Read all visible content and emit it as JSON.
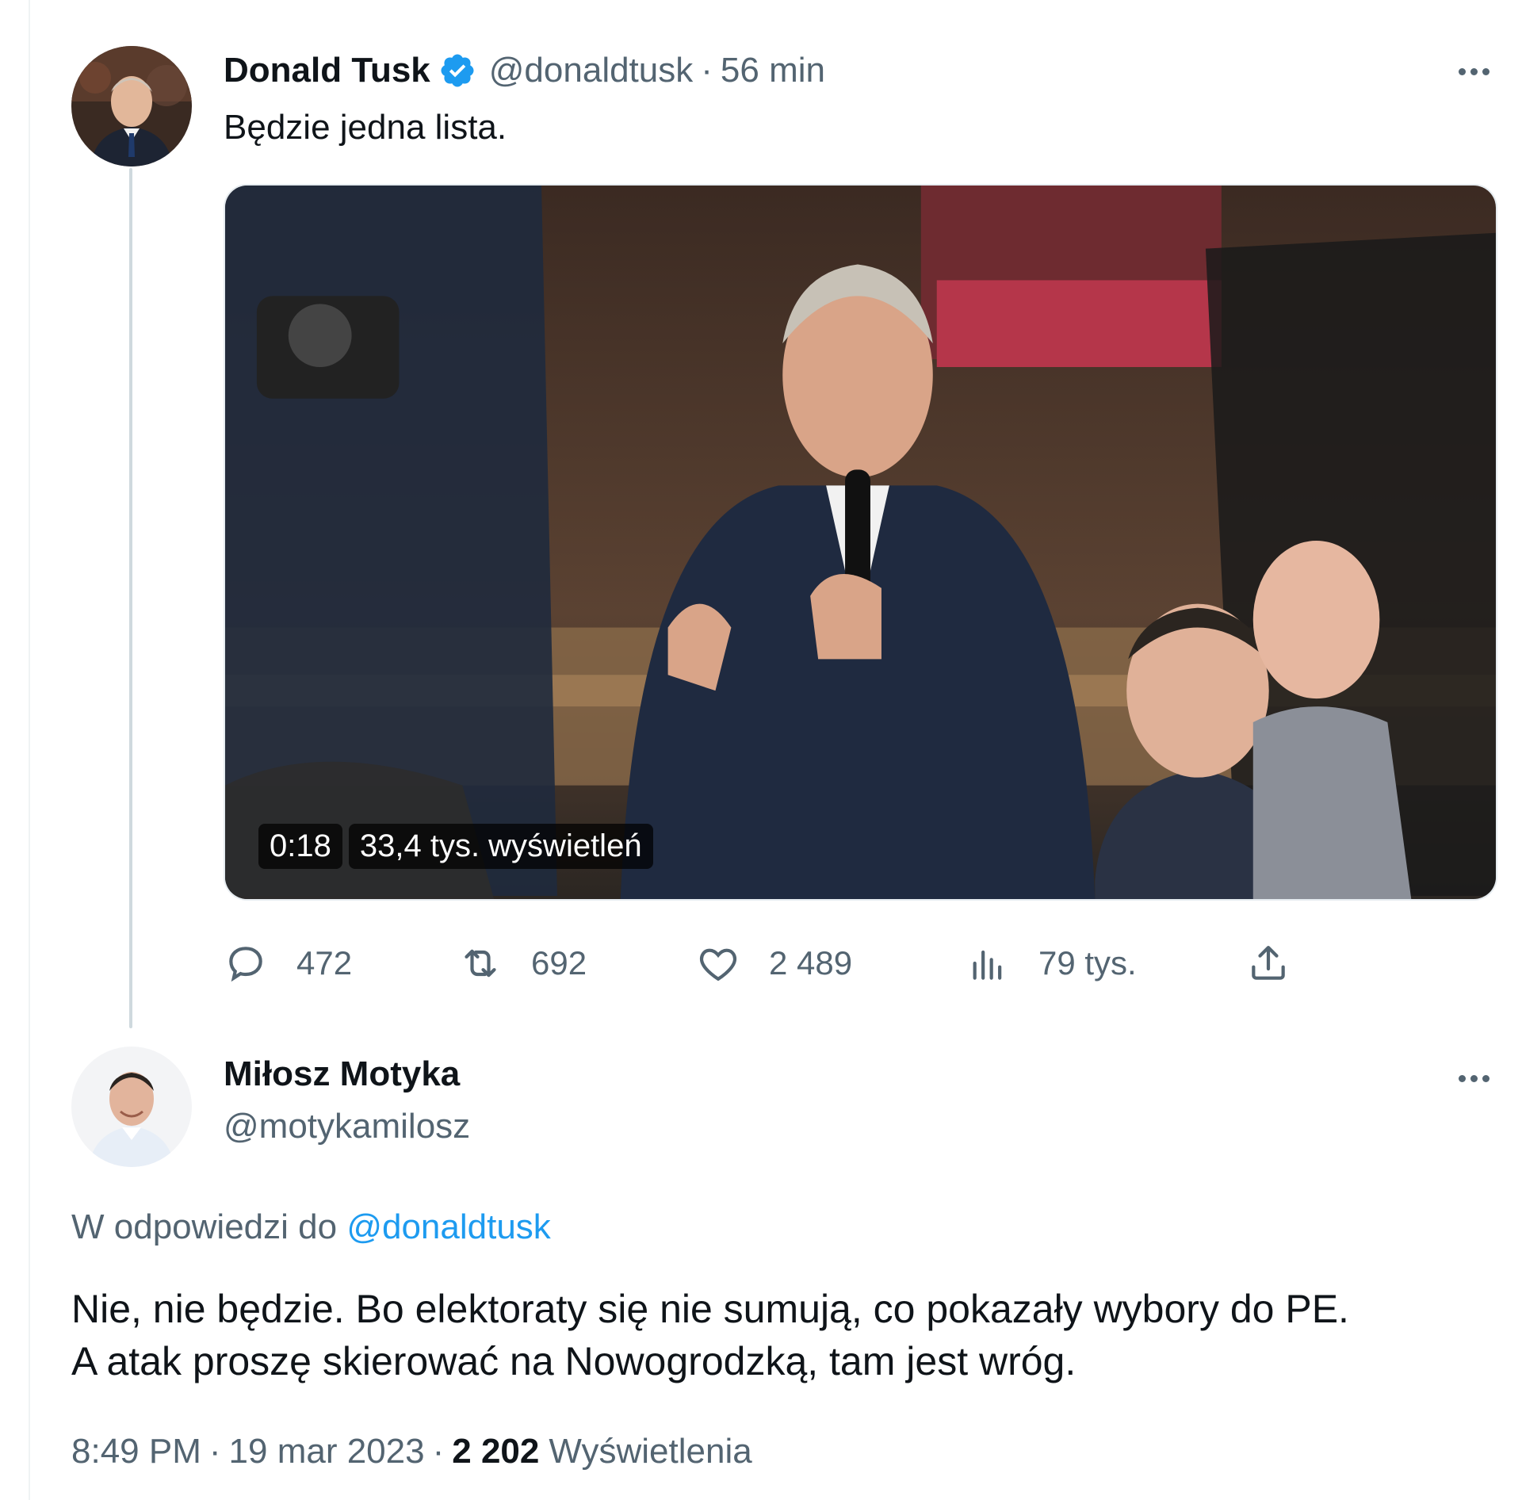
{
  "tweet": {
    "author_name": "Donald Tusk",
    "author_handle": "@donaldtusk",
    "separator": "·",
    "time_ago": "56 min",
    "text": "Będzie jedna lista.",
    "media": {
      "duration": "0:18",
      "views": "33,4 tys. wyświetleń"
    },
    "actions": {
      "replies": "472",
      "reposts": "692",
      "likes": "2 489",
      "views": "79 tys."
    }
  },
  "reply": {
    "author_name": "Miłosz Motyka",
    "author_handle": "@motykamilosz",
    "reply_to_label": "W odpowiedzi do",
    "reply_to_mention": "@donaldtusk",
    "text_line1": "Nie, nie będzie. Bo elektoraty się nie sumują, co pokazały wybory do PE.",
    "text_line2": "A atak proszę skierować na Nowogrodzką, tam jest wróg.",
    "time": "8:49 PM",
    "separator": "·",
    "date": "19 mar 2023",
    "views_count": "2 202",
    "views_label": "Wyświetlenia"
  },
  "colors": {
    "verified_blue": "#1d9bf0",
    "secondary_text": "#536471",
    "primary_text": "#0f1419"
  }
}
